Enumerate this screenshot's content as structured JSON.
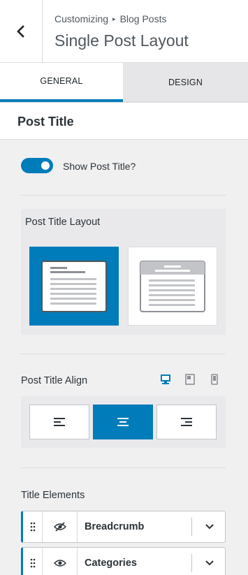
{
  "header": {
    "breadcrumb_root": "Customizing",
    "breadcrumb_sep": "▸",
    "breadcrumb_section": "Blog Posts",
    "title": "Single Post Layout",
    "back_icon": "chevron-left-icon"
  },
  "tabs": [
    {
      "label": "GENERAL",
      "active": true
    },
    {
      "label": "DESIGN",
      "active": false
    }
  ],
  "section": {
    "title": "Post Title"
  },
  "show_title": {
    "label": "Show Post Title?",
    "enabled": true
  },
  "layout": {
    "label": "Post Title Layout",
    "options": [
      {
        "name": "normal",
        "selected": true
      },
      {
        "name": "above",
        "selected": false
      }
    ]
  },
  "align": {
    "label": "Post Title Align",
    "devices": [
      "desktop-icon",
      "tablet-icon",
      "mobile-icon"
    ],
    "active_device": "desktop",
    "options": [
      {
        "name": "left",
        "selected": false
      },
      {
        "name": "center",
        "selected": true
      },
      {
        "name": "right",
        "selected": false
      }
    ]
  },
  "elements": {
    "label": "Title Elements",
    "items": [
      {
        "label": "Breadcrumb",
        "visible": false
      },
      {
        "label": "Categories",
        "visible": true
      }
    ]
  },
  "colors": {
    "accent": "#007cba",
    "panel": "#e9e9ec",
    "background": "#f0f0f1"
  }
}
